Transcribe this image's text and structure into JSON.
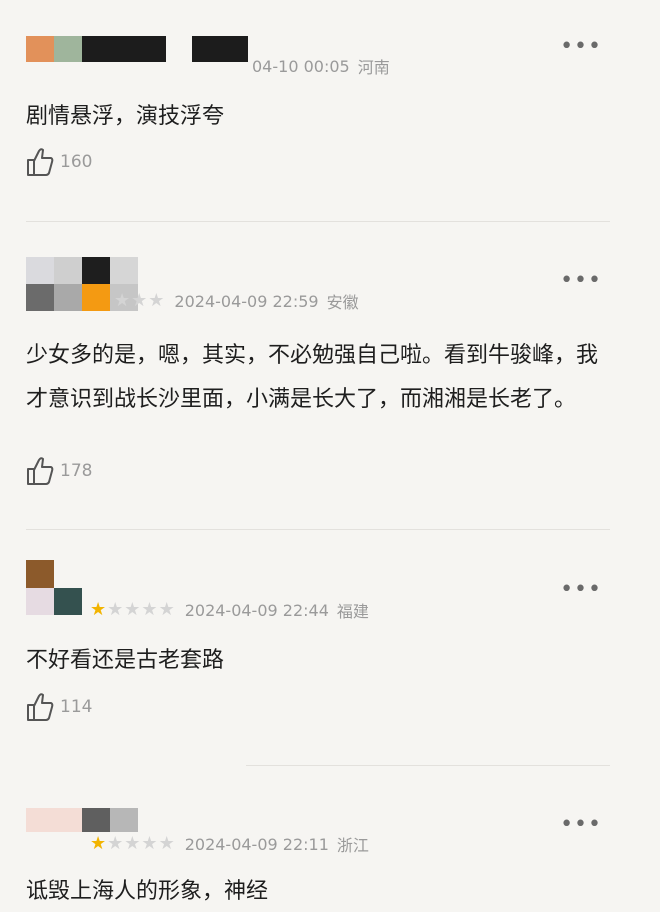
{
  "comments": [
    {
      "stars": 0,
      "date": "2024-04-10 00:05",
      "date_display": "04-10 00:05",
      "location": "河南",
      "text": "剧情悬浮，演技浮夸",
      "likes": "160",
      "avatar_colors": [
        "#e2915a",
        "#9fb59c",
        "#1c1c1c",
        "#1c1c1c"
      ]
    },
    {
      "stars": 0,
      "date": "2024-04-09 22:59",
      "location": "安徽",
      "text": "少女多的是，嗯，其实，不必勉强自己啦。看到牛骏峰，我才意识到战长沙里面，小满是长大了，而湘湘是长老了。",
      "likes": "178",
      "avatar_colors": [
        "#dadade",
        "#cfcfcf",
        "#1e1e1e",
        "#d6d6d6",
        "#6b6b6b",
        "#a9a9a9",
        "#f49a12",
        "#c6c6c6"
      ]
    },
    {
      "stars": 1,
      "date": "2024-04-09 22:44",
      "location": "福建",
      "text": "不好看还是古老套路",
      "likes": "114",
      "avatar_colors": [
        "#8c5a2b",
        "#e6dbe2",
        "#34514f"
      ]
    },
    {
      "stars": 1,
      "date": "2024-04-09 22:11",
      "location": "浙江",
      "text": "诋毁上海人的形象，神经",
      "likes": "",
      "avatar_colors": [
        "#f4ddd6",
        "#5f5f5f",
        "#b7b7b7"
      ]
    }
  ],
  "icons": {
    "more": "more-horizontal-icon",
    "like": "thumbs-up-icon",
    "star": "star-icon"
  },
  "colors": {
    "star_on": "#f2b400",
    "star_off": "#d4d4d4",
    "meta": "#9a9a9a"
  },
  "more_label": "•••"
}
